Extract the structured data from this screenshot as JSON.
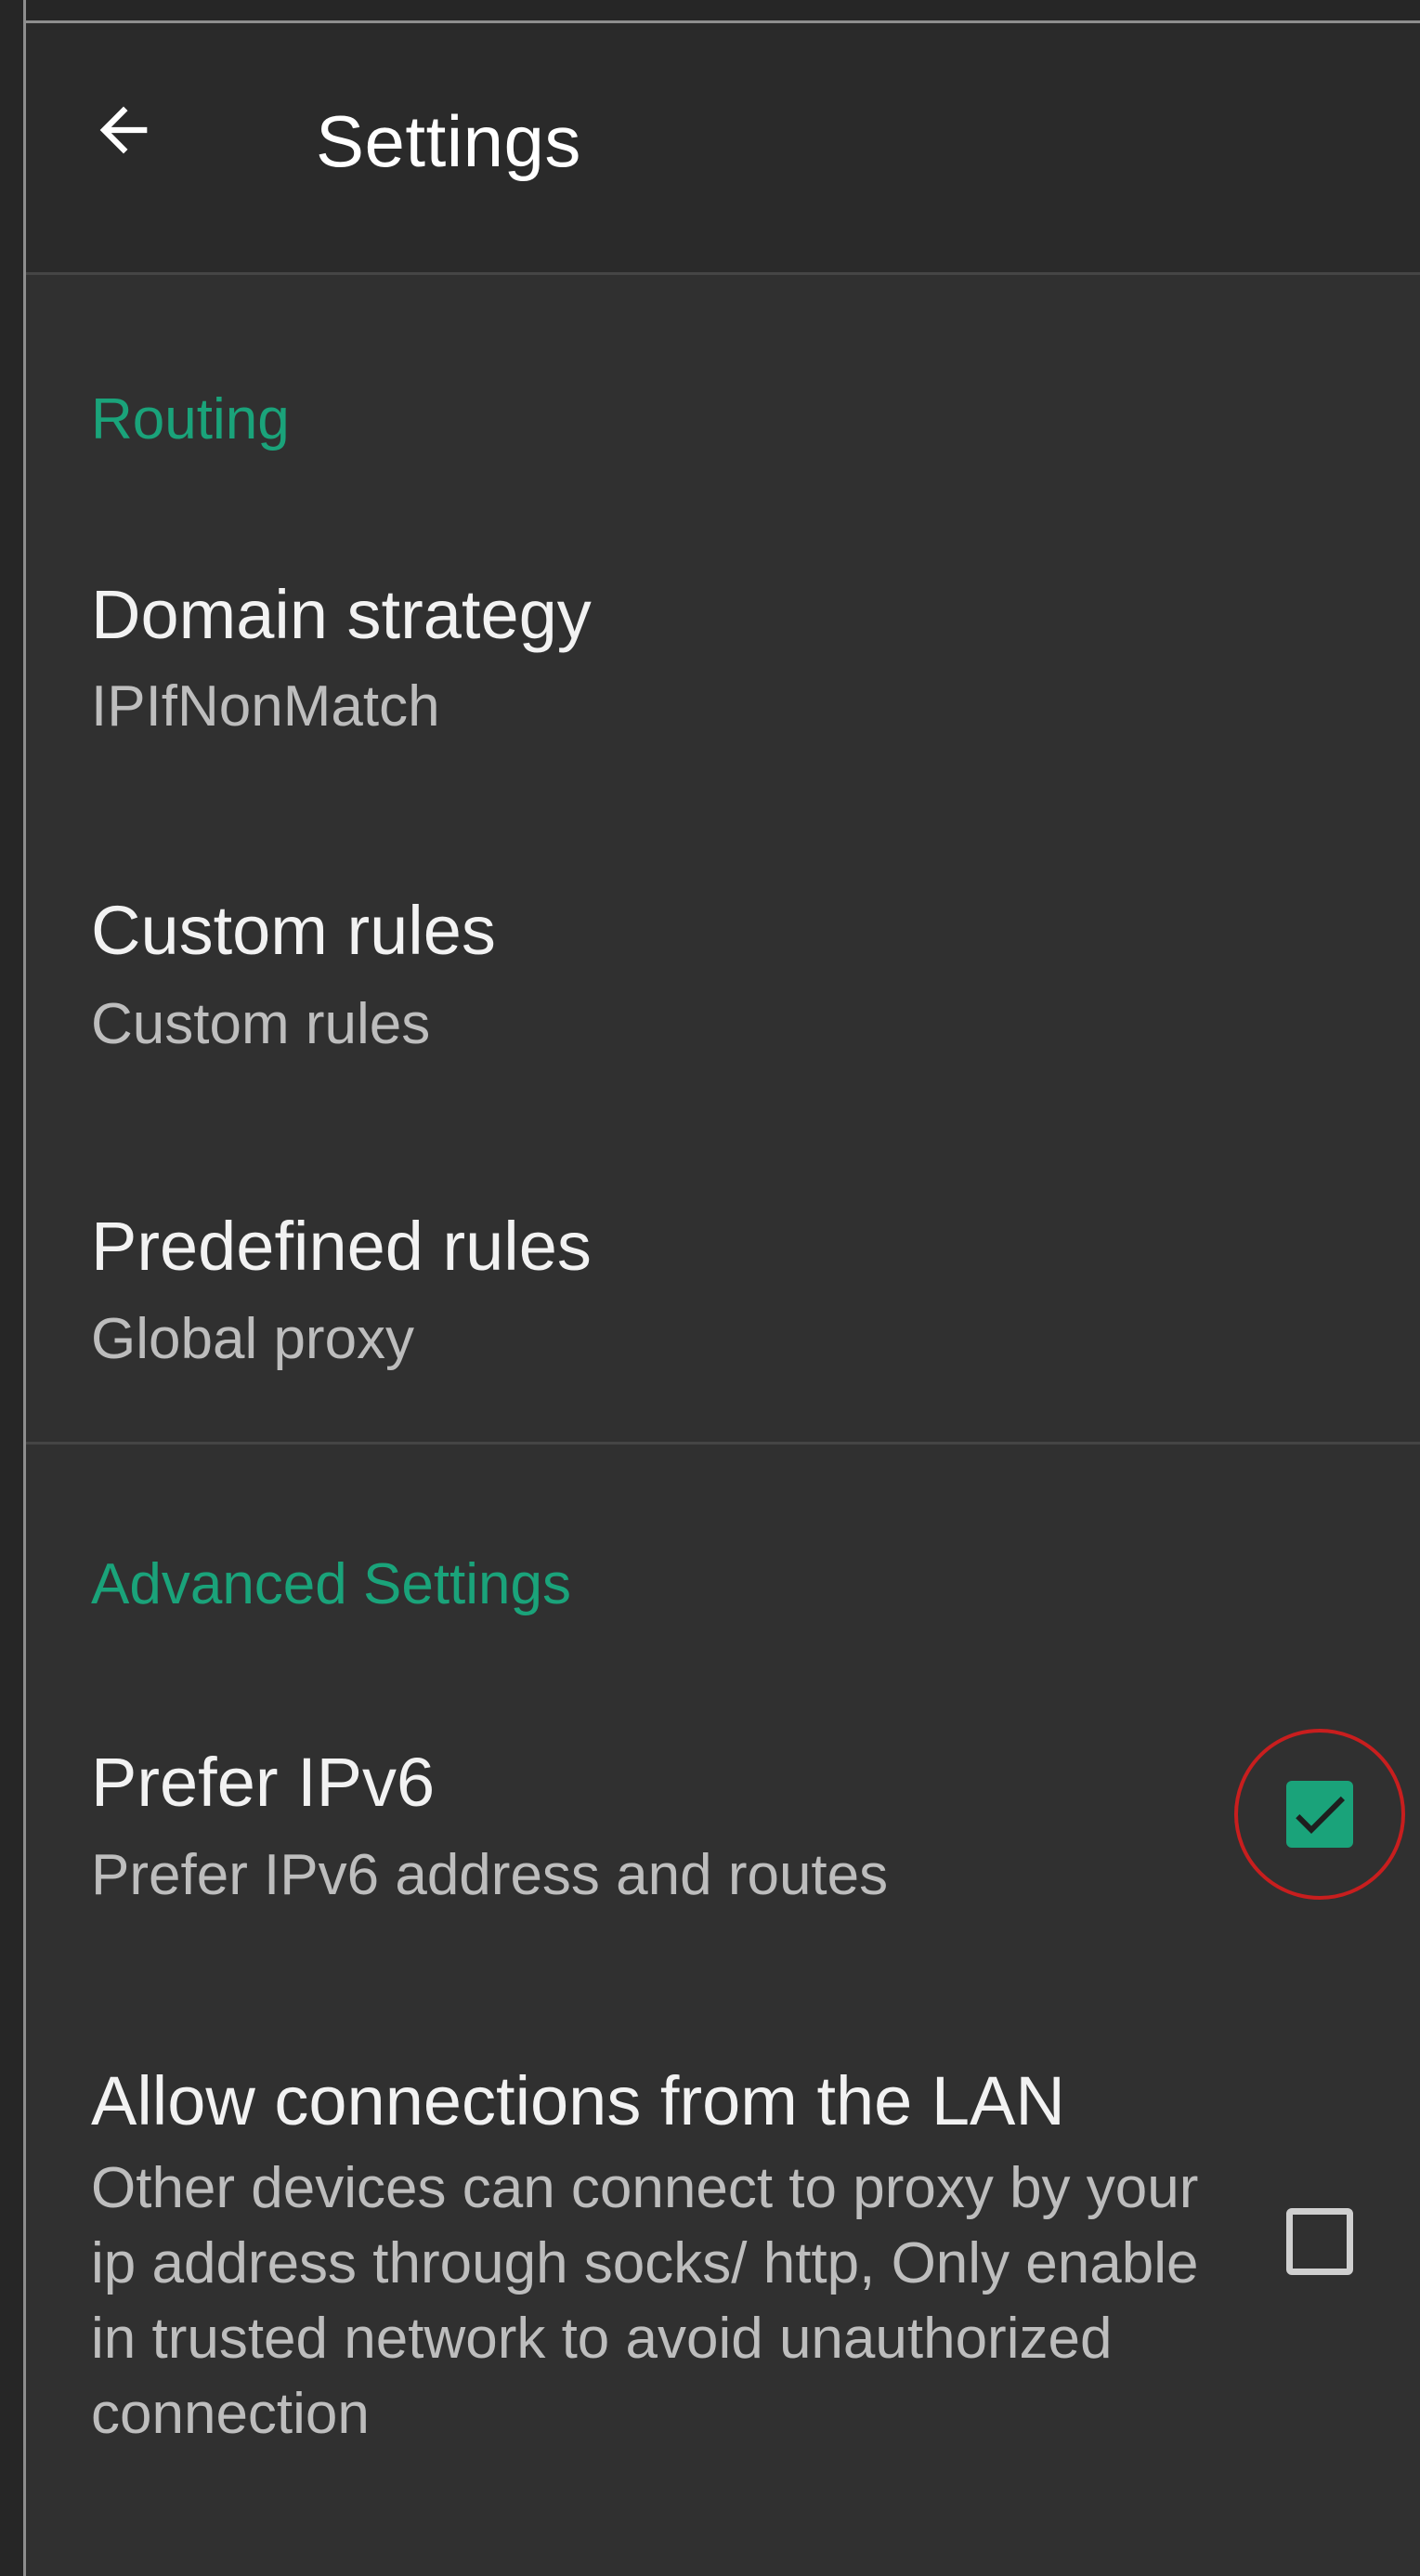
{
  "appbar": {
    "title": "Settings",
    "back_icon": "arrow-left-icon"
  },
  "sections": [
    {
      "category": "Routing",
      "items": [
        {
          "title": "Domain strategy",
          "summary": "IPIfNonMatch"
        },
        {
          "title": "Custom rules",
          "summary": "Custom rules"
        },
        {
          "title": "Predefined rules",
          "summary": "Global proxy"
        }
      ]
    },
    {
      "category": "Advanced Settings",
      "items": [
        {
          "title": "Prefer IPv6",
          "summary": "Prefer IPv6 address and routes",
          "checked": true
        },
        {
          "title": "Allow connections from the LAN",
          "summary": "Other devices can connect to proxy by your ip address through socks/ http, Only enable in trusted network to avoid unauthorized connection",
          "checked": false
        }
      ]
    }
  ],
  "colors": {
    "accent": "#1aa37a",
    "background": "#303030",
    "highlight": "#c81e1e"
  }
}
